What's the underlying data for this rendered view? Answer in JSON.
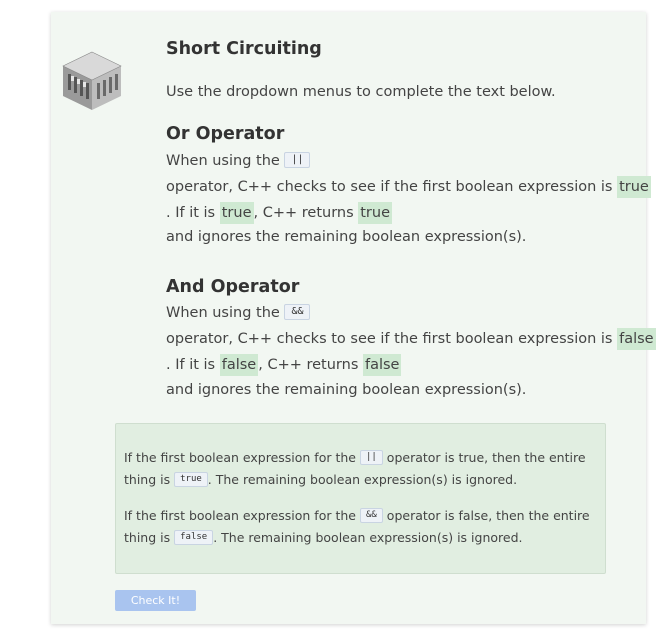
{
  "title": "Short Circuiting",
  "intro": "Use the dropdown menus to complete the text below.",
  "or_section": {
    "heading": "Or Operator",
    "line1_prefix": "When using the",
    "operator": "||",
    "line2_text": " operator, C++ checks to see if the first boolean expression is",
    "dropdown_1": "true",
    "line3_prefix": ". If it is",
    "dropdown_2": "true",
    "line3_middle": ", C++ returns",
    "dropdown_3": "true",
    "line4_text": " and ignores the remaining boolean expression(s)."
  },
  "and_section": {
    "heading": "And Operator",
    "line1_prefix": "When using the",
    "operator": "&&",
    "line2_text": " operator, C++ checks to see if the first boolean expression is",
    "dropdown_1": "false",
    "line3_prefix": ". If it is",
    "dropdown_2": "false",
    "line3_middle": ", C++ returns",
    "dropdown_3": "false",
    "line4_text": " and ignores the remaining boolean expression(s)."
  },
  "summary": {
    "or_text1": "If the first boolean expression for the",
    "or_operator": "||",
    "or_text2": "operator is true, then the entire thing is",
    "or_value": "true",
    "or_text3": ". The remaining boolean expression(s) is ignored.",
    "and_text1": "If the first boolean expression for the",
    "and_operator": "&&",
    "and_text2": "operator is false, then the entire thing is",
    "and_value": "false",
    "and_text3": ". The remaining boolean expression(s) is ignored."
  },
  "check_button": "Check It!",
  "icons": {
    "logo": "building-logo-icon"
  },
  "colors": {
    "card_bg": "#f2f7f2",
    "dropdown_bg": "#cfe9d2",
    "summary_bg": "#e1eee1",
    "button_bg": "#a9c4ef"
  }
}
